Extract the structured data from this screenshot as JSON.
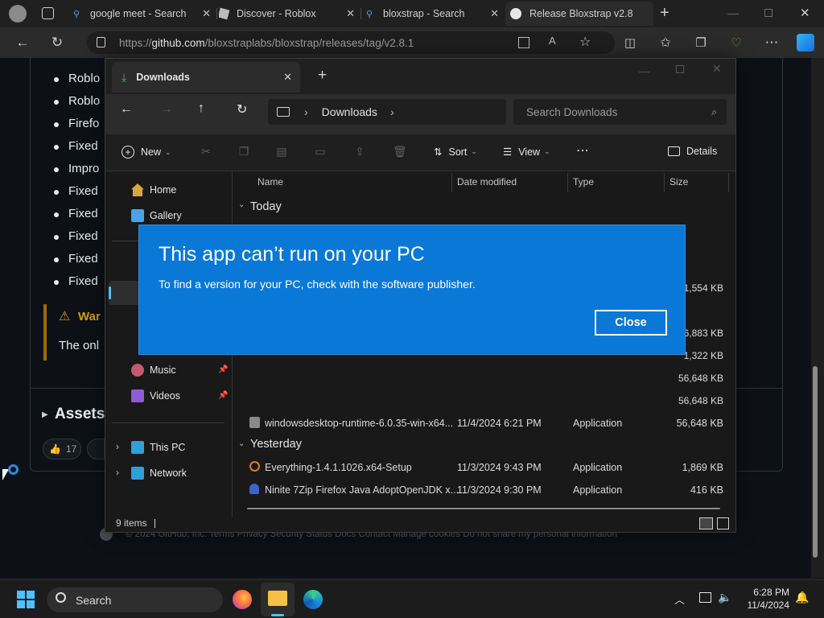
{
  "browser": {
    "tabs": [
      {
        "label": "google meet - Search",
        "icon": "search-icon"
      },
      {
        "label": "Discover - Roblox",
        "icon": "roblox-icon"
      },
      {
        "label": "bloxstrap - Search",
        "icon": "search-icon"
      },
      {
        "label": "Release Bloxstrap v2.8",
        "icon": "github-icon"
      }
    ],
    "url_prefix": "https://",
    "url_host": "github.com",
    "url_path": "/bloxstraplabs/bloxstrap/releases/tag/v2.8.1"
  },
  "page_behind": {
    "bullets": [
      "Roblo",
      "Roblo",
      "Firefo",
      "Fixed",
      "Impro",
      "Fixed",
      "Fixed",
      "Fixed",
      "Fixed",
      "Fixed"
    ],
    "warning": "War",
    "warning_text": "The onl",
    "assets_label": "Assets",
    "reaction_count": "17",
    "footer": "© 2024 GitHub, Inc.   Terms   Privacy   Security   Status   Docs   Contact   Manage cookies   Do not share my personal information"
  },
  "explorer": {
    "tab_title": "Downloads",
    "breadcrumb": "Downloads",
    "search_placeholder": "Search Downloads",
    "commands": {
      "new": "New",
      "sort": "Sort",
      "view": "View",
      "details": "Details"
    },
    "sidebar": {
      "home": "Home",
      "gallery": "Gallery",
      "music": "Music",
      "videos": "Videos",
      "this_pc": "This PC",
      "network": "Network"
    },
    "columns": {
      "name": "Name",
      "date": "Date modified",
      "type": "Type",
      "size": "Size"
    },
    "groups": {
      "today": "Today",
      "yesterday": "Yesterday"
    },
    "hidden_sizes": [
      "1,554 KB",
      "6,883 KB",
      "1,322 KB",
      "56,648 KB",
      "56,648 KB"
    ],
    "rows": [
      {
        "name": "windowsdesktop-runtime-6.0.35-win-x64...",
        "date": "11/4/2024 6:21 PM",
        "type": "Application",
        "size": "56,648 KB"
      },
      {
        "name": "Everything-1.4.1.1026.x64-Setup",
        "date": "11/3/2024 9:43 PM",
        "type": "Application",
        "size": "1,869 KB"
      },
      {
        "name": "Ninite 7Zip Firefox Java AdoptOpenJDK x...",
        "date": "11/3/2024 9:30 PM",
        "type": "Application",
        "size": "416 KB"
      }
    ],
    "status": "9 items"
  },
  "dialog": {
    "title": "This app can’t run on your PC",
    "message": "To find a version for your PC, check with the software publisher.",
    "close_label": "Close"
  },
  "taskbar": {
    "search_label": "Search",
    "time": "6:28 PM",
    "date": "11/4/2024"
  },
  "colors": {
    "dialog_blue": "#0a78d6",
    "page_bg": "#0d1117",
    "explorer_bg": "#191919"
  }
}
